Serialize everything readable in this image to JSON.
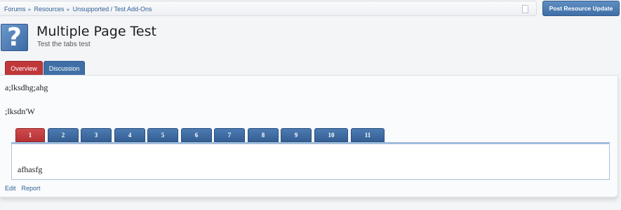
{
  "breadcrumb": {
    "items": [
      "Forums",
      "Resources",
      "Unsupported / Test Add-Ons"
    ],
    "separator": "▸"
  },
  "post_button_label": "Post Resource Update",
  "resource": {
    "icon_glyph": "?",
    "title": "Multiple Page Test",
    "tagline": "Test the tabs test"
  },
  "tabs": [
    {
      "label": "Overview",
      "active": true
    },
    {
      "label": "Discussion",
      "active": false
    }
  ],
  "content": {
    "line1": "a;lksdhg;ahg",
    "line2": ";lksdn'W"
  },
  "page_tabs": [
    {
      "label": "1",
      "active": true
    },
    {
      "label": "2",
      "active": false
    },
    {
      "label": "3",
      "active": false
    },
    {
      "label": "4",
      "active": false
    },
    {
      "label": "5",
      "active": false
    },
    {
      "label": "6",
      "active": false
    },
    {
      "label": "7",
      "active": false
    },
    {
      "label": "8",
      "active": false
    },
    {
      "label": "9",
      "active": false
    },
    {
      "label": "10",
      "active": false
    },
    {
      "label": "11",
      "active": false
    }
  ],
  "page_content": "afhasfg",
  "actions": [
    "Edit",
    "Report"
  ],
  "colors": {
    "accent_blue": "#3f6fa6",
    "active_red": "#c0373a",
    "link": "#2f5f96"
  }
}
